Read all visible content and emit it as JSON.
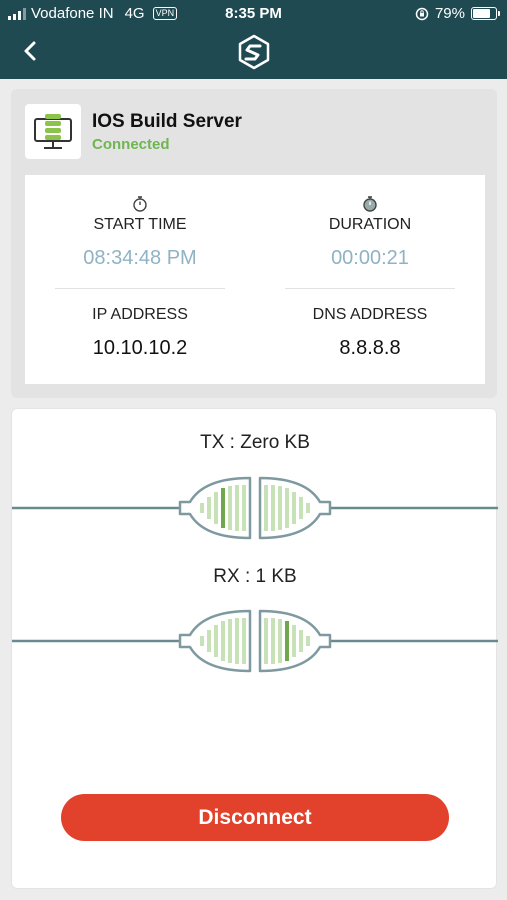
{
  "status_bar": {
    "carrier": "Vodafone IN",
    "network": "4G",
    "vpn_badge": "VPN",
    "time": "8:35 PM",
    "battery_percent": "79%",
    "battery_level": 0.79
  },
  "header": {
    "back_icon": "chevron-left-icon",
    "logo_icon": "app-logo-icon"
  },
  "server": {
    "icon": "server-monitor-icon",
    "name": "IOS Build Server",
    "status": "Connected"
  },
  "stats": {
    "start_time_label": "START TIME",
    "start_time_value": "08:34:48 PM",
    "duration_label": "DURATION",
    "duration_value": "00:00:21",
    "ip_label": "IP ADDRESS",
    "ip_value": "10.10.10.2",
    "dns_label": "DNS ADDRESS",
    "dns_value": "8.8.8.8"
  },
  "traffic": {
    "tx_label": "TX : Zero KB",
    "rx_label": "RX : 1 KB"
  },
  "actions": {
    "disconnect_label": "Disconnect"
  },
  "colors": {
    "header_bg": "#1f4a52",
    "connected_green": "#6fb552",
    "muted_value": "#8fb3c4",
    "disconnect_red": "#e2412b"
  }
}
